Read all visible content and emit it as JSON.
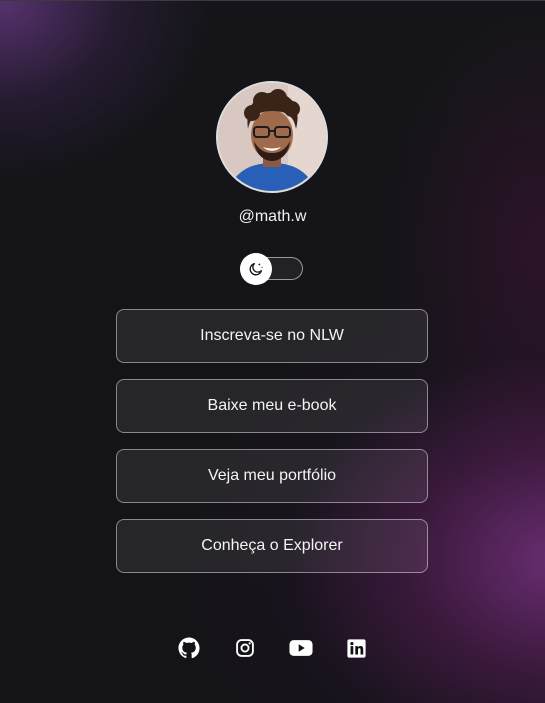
{
  "profile": {
    "username": "@math.w",
    "avatar_icon": "profile-photo"
  },
  "theme_switch": {
    "icon": "moon-icon",
    "state": "dark"
  },
  "links": [
    {
      "label": "Inscreva-se no NLW"
    },
    {
      "label": "Baixe meu e-book"
    },
    {
      "label": "Veja meu portfólio"
    },
    {
      "label": "Conheça o Explorer"
    }
  ],
  "socials": [
    {
      "icon": "github-icon"
    },
    {
      "icon": "instagram-icon"
    },
    {
      "icon": "youtube-icon"
    },
    {
      "icon": "linkedin-icon"
    }
  ],
  "colors": {
    "background": "#121214",
    "accent_purple": "#6e3c8c",
    "text": "#ffffff"
  }
}
